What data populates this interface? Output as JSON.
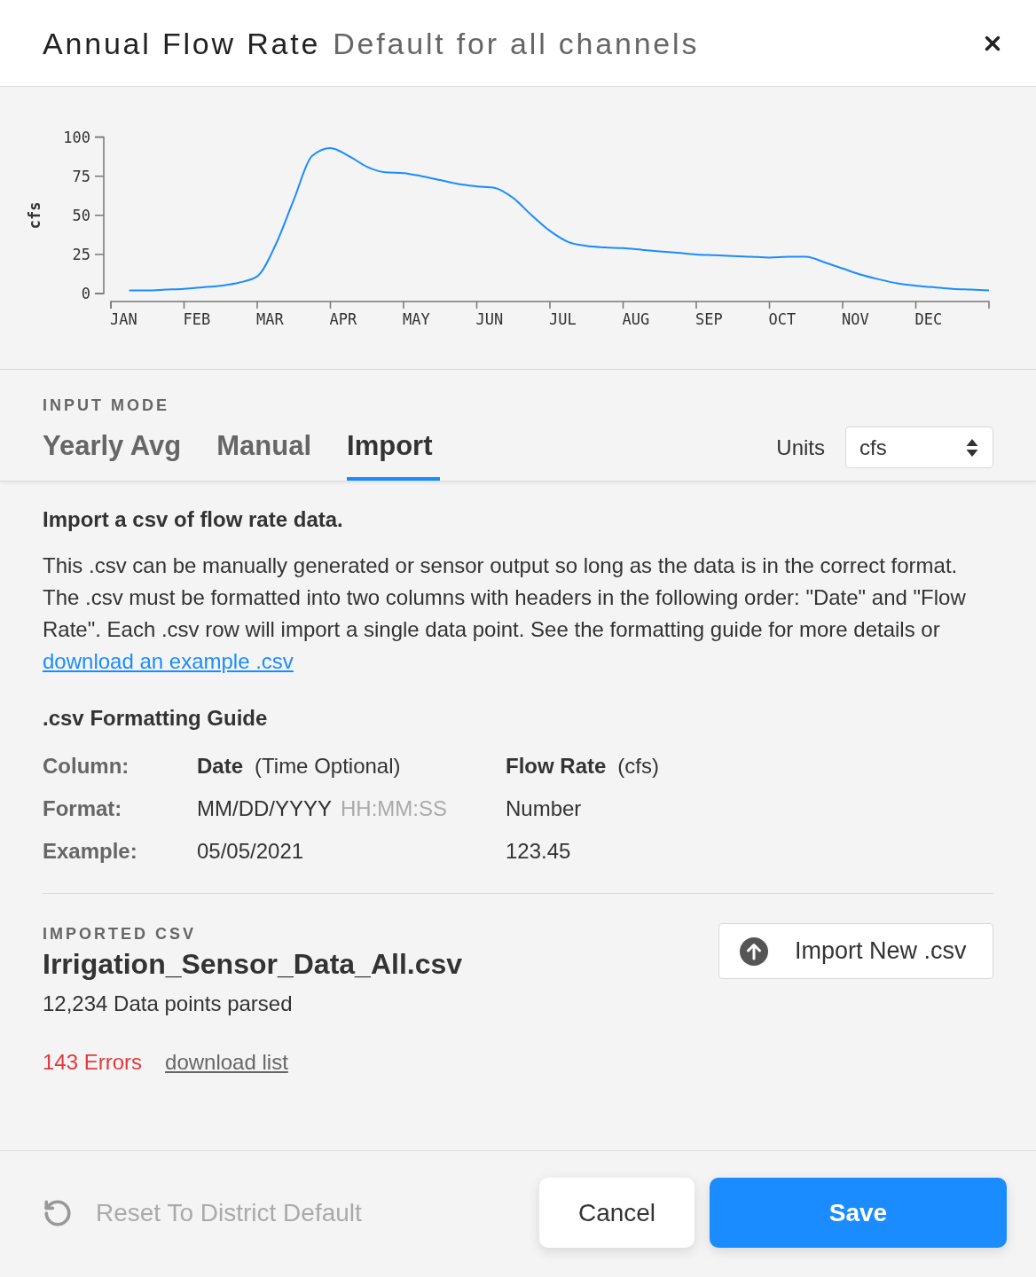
{
  "dialog": {
    "title": "Annual Flow Rate",
    "subtitle": "Default for all channels"
  },
  "chart": {
    "chart_data": {
      "type": "line",
      "ylabel": "cfs",
      "categories": [
        "JAN",
        null,
        null,
        null,
        "FEB",
        null,
        null,
        null,
        "MAR",
        null,
        null,
        null,
        "APR",
        null,
        null,
        null,
        "MAY",
        null,
        null,
        null,
        "JUN",
        null,
        null,
        null,
        "JUL",
        null,
        null,
        null,
        "AUG",
        null,
        null,
        null,
        "SEP",
        null,
        null,
        null,
        "OCT",
        null,
        null,
        null,
        "NOV",
        null,
        null,
        null,
        "DEC",
        null,
        null,
        null
      ],
      "series": [
        {
          "color": "#1a8cff",
          "values": [
            2,
            2,
            2.5,
            3,
            4,
            5,
            7,
            11,
            31,
            60,
            88,
            93,
            88,
            81,
            77.5,
            77,
            75,
            72.5,
            70,
            68.5,
            67.5,
            61,
            50,
            40,
            33,
            30.5,
            29.5,
            29,
            28,
            27,
            26,
            25,
            24.5,
            24,
            23.5,
            23,
            23.5,
            23.5,
            20,
            16,
            12,
            9,
            6.5,
            5,
            4,
            3,
            2.5,
            2
          ]
        }
      ],
      "ylim": [
        0,
        100
      ],
      "yticks": [
        0,
        25,
        50,
        75,
        100
      ]
    }
  },
  "input_mode": {
    "label": "INPUT MODE",
    "tabs": [
      {
        "label": "Yearly Avg",
        "selected": false
      },
      {
        "label": "Manual",
        "selected": false
      },
      {
        "label": "Import",
        "selected": true
      }
    ],
    "units": {
      "label": "Units",
      "value": "cfs"
    }
  },
  "import_panel": {
    "heading": "Import a csv of flow rate data.",
    "description": "This .csv can be manually generated or sensor output so long as the data is in the correct format. The .csv must be formatted into two columns with headers in the following order: \"Date\" and \"Flow Rate\". Each .csv row will import a single data point. See the formatting guide for more details or",
    "link": "download an example .csv"
  },
  "formatting_guide": {
    "title": ".csv Formatting Guide",
    "rows": [
      {
        "kind": "header",
        "label": "Column:",
        "cells": [
          {
            "text": "Date",
            "note": "(Time Optional)"
          },
          {
            "text": "Flow Rate",
            "note": "(cfs)"
          }
        ]
      },
      {
        "kind": "format",
        "label": "Format:",
        "cells": [
          {
            "text": "MM/DD/YYYY",
            "note": "HH:MM:SS"
          },
          {
            "text": "Number"
          }
        ]
      },
      {
        "kind": "example",
        "label": "Example:",
        "cells": [
          {
            "text": "05/05/2021"
          },
          {
            "text": "123.45"
          }
        ]
      }
    ]
  },
  "imported_csv": {
    "label": "IMPORTED CSV",
    "filename": "Irrigation_Sensor_Data_All.csv",
    "summary": "12,234 Data points parsed",
    "errors": "143 Errors",
    "errors_link": "download list",
    "import_button": "Import New .csv"
  },
  "footer": {
    "reset": {
      "label": "Reset To District Default",
      "disabled": true
    },
    "cancel": "Cancel",
    "save": "Save"
  }
}
